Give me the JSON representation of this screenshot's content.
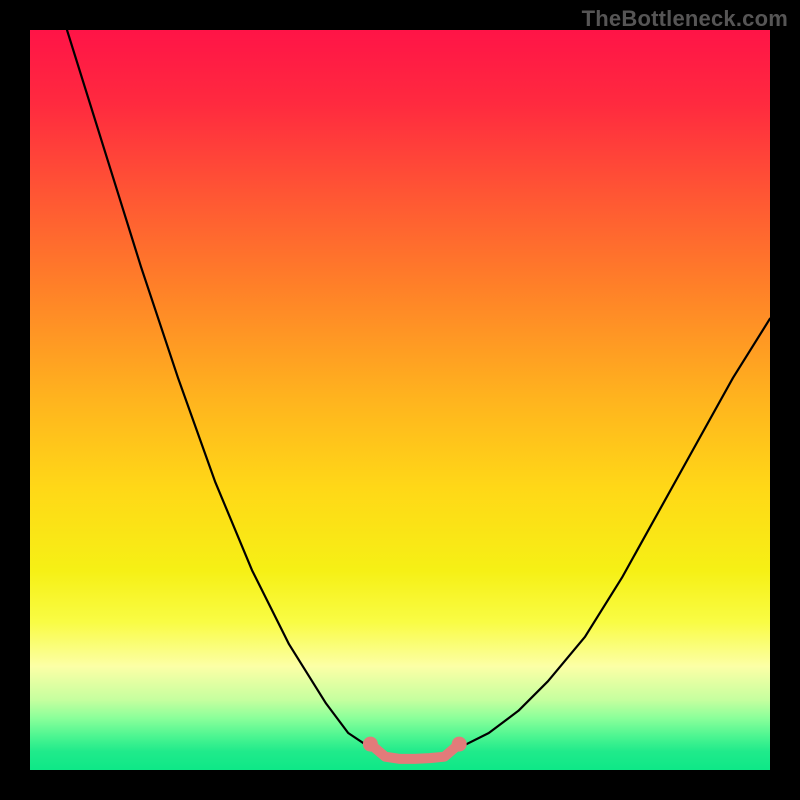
{
  "watermark": "TheBottleneck.com",
  "chart_data": {
    "type": "line",
    "title": "",
    "xlabel": "",
    "ylabel": "",
    "xlim": [
      0,
      100
    ],
    "ylim": [
      0,
      100
    ],
    "grid": false,
    "legend": false,
    "series": [
      {
        "name": "curve-left",
        "color": "#000000",
        "x": [
          5,
          10,
          15,
          20,
          25,
          30,
          35,
          40,
          43,
          46
        ],
        "y": [
          100,
          84,
          68,
          53,
          39,
          27,
          17,
          9,
          5,
          3
        ]
      },
      {
        "name": "curve-right",
        "color": "#000000",
        "x": [
          58,
          62,
          66,
          70,
          75,
          80,
          85,
          90,
          95,
          100
        ],
        "y": [
          3,
          5,
          8,
          12,
          18,
          26,
          35,
          44,
          53,
          61
        ]
      },
      {
        "name": "bottom-marker",
        "color": "#e27b7a",
        "x": [
          46,
          48,
          50,
          52,
          54,
          56,
          58
        ],
        "y": [
          3.5,
          1.8,
          1.5,
          1.5,
          1.6,
          1.8,
          3.5
        ]
      }
    ],
    "background_gradient": {
      "stops": [
        {
          "offset": 0.0,
          "color": "#ff1447"
        },
        {
          "offset": 0.1,
          "color": "#ff2a3f"
        },
        {
          "offset": 0.22,
          "color": "#ff5534"
        },
        {
          "offset": 0.35,
          "color": "#ff8128"
        },
        {
          "offset": 0.5,
          "color": "#ffb41e"
        },
        {
          "offset": 0.62,
          "color": "#ffd817"
        },
        {
          "offset": 0.73,
          "color": "#f6f015"
        },
        {
          "offset": 0.8,
          "color": "#f9fc44"
        },
        {
          "offset": 0.86,
          "color": "#fcffa6"
        },
        {
          "offset": 0.905,
          "color": "#c6ff9f"
        },
        {
          "offset": 0.93,
          "color": "#8aff9a"
        },
        {
          "offset": 0.955,
          "color": "#4bf591"
        },
        {
          "offset": 0.975,
          "color": "#20ea8b"
        },
        {
          "offset": 1.0,
          "color": "#0ee887"
        }
      ]
    }
  }
}
